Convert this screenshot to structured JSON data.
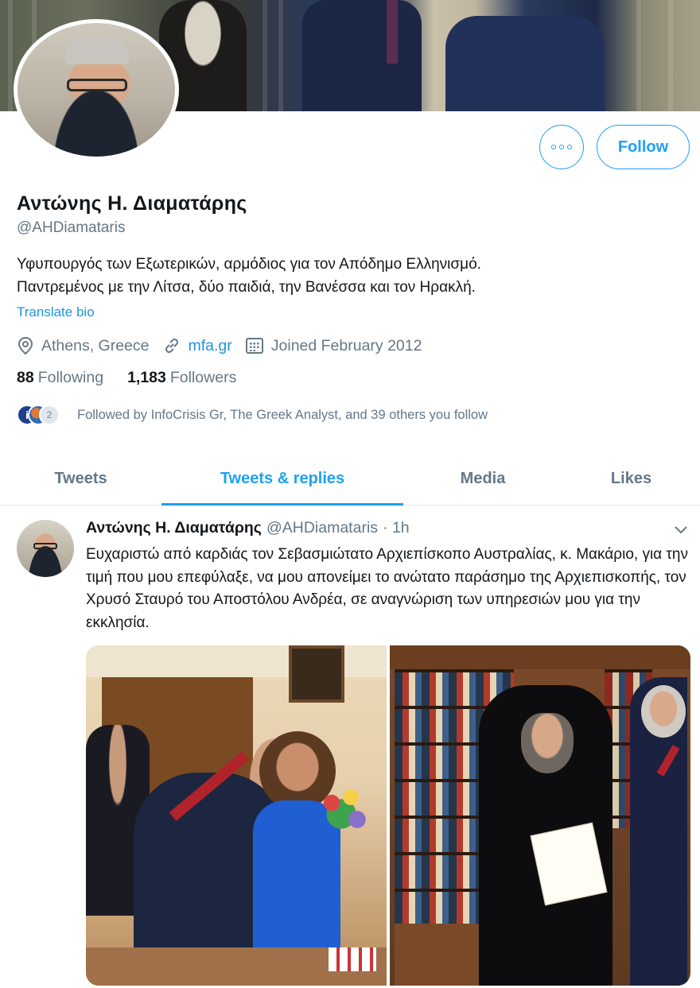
{
  "profile": {
    "name": "Αντώνης Η. Διαματάρης",
    "handle": "@AHDiamataris",
    "bio_line1": "Υφυπουργός των Εξωτερικών, αρμόδιος για τον Απόδημο Ελληνισμό.",
    "bio_line2": "Παντρεμένος με την Λίτσα, δύο παιδιά, την Βανέσσα και τον Ηρακλή.",
    "translate_label": "Translate bio",
    "location": "Athens, Greece",
    "website": "mfa.gr",
    "joined": "Joined February 2012",
    "following_count": "88",
    "following_label": "Following",
    "followers_count": "1,183",
    "followers_label": "Followers",
    "followed_by": "Followed by InfoCrisis Gr, The Greek Analyst, and 39 others you follow"
  },
  "actions": {
    "follow_label": "Follow",
    "more_icon": "more-dots-icon"
  },
  "tabs": [
    {
      "label": "Tweets"
    },
    {
      "label": "Tweets & replies"
    },
    {
      "label": "Media"
    },
    {
      "label": "Likes"
    }
  ],
  "tweet": {
    "author": "Αντώνης Η. Διαματάρης",
    "handle": "@AHDiamataris",
    "time": "· 1h",
    "text": "Ευχαριστώ από καρδιάς τον Σεβασμιώτατο Αρχιεπίσκοπο Αυστραλίας, κ. Μακάριο, για την τιμή που μου επεφύλαξε, να μου απονείμει το ανώτατο παράσημο της Αρχιεπισκοπής, τον Χρυσό Σταυρό του Αποστόλου Ανδρέα, σε αναγνώριση των υπηρεσιών μου για την εκκλησία."
  },
  "colors": {
    "accent": "#1da1f2",
    "link": "#1b95e0",
    "secondary_text": "#657786",
    "primary_text": "#14171a"
  }
}
